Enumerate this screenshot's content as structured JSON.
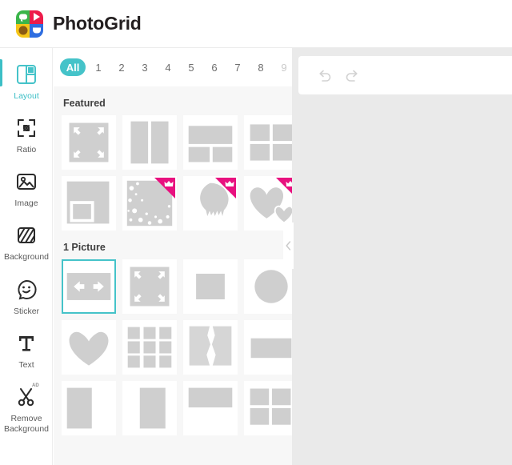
{
  "header": {
    "app_title": "PhotoGrid",
    "logo_colors": {
      "green": "#3bb54a",
      "red": "#ed1c4a",
      "yellow": "#f5c518",
      "blue": "#2f6ee0"
    }
  },
  "theme": {
    "accent": "#45c3c9",
    "premium": "#e8117f",
    "panel_bg": "#f7f7f7",
    "canvas_bg": "#eaeaea"
  },
  "sidebar": {
    "items": [
      {
        "label": "Layout",
        "icon": "layout-icon",
        "active": true
      },
      {
        "label": "Ratio",
        "icon": "ratio-icon",
        "active": false
      },
      {
        "label": "Image",
        "icon": "image-icon",
        "active": false
      },
      {
        "label": "Background",
        "icon": "background-icon",
        "active": false
      },
      {
        "label": "Sticker",
        "icon": "sticker-icon",
        "active": false
      },
      {
        "label": "Text",
        "icon": "text-icon",
        "active": false
      },
      {
        "label": "Remove Background",
        "icon": "scissors-icon",
        "active": false,
        "badge": "AD"
      }
    ]
  },
  "panel": {
    "tabs": [
      {
        "label": "All",
        "active": true
      },
      {
        "label": "1",
        "active": false
      },
      {
        "label": "2",
        "active": false
      },
      {
        "label": "3",
        "active": false
      },
      {
        "label": "4",
        "active": false
      },
      {
        "label": "5",
        "active": false
      },
      {
        "label": "6",
        "active": false
      },
      {
        "label": "7",
        "active": false
      },
      {
        "label": "8",
        "active": false
      },
      {
        "label": "9",
        "active": false,
        "faded": true
      }
    ],
    "next_icon": "chevron-right-icon",
    "sections": [
      {
        "title": "Featured",
        "items": [
          {
            "name": "expand-corners-layout",
            "premium": false,
            "selected": false
          },
          {
            "name": "two-column-layout",
            "premium": false,
            "selected": false
          },
          {
            "name": "one-top-two-bottom-layout",
            "premium": false,
            "selected": false
          },
          {
            "name": "four-grid-layout",
            "premium": false,
            "selected": false
          },
          {
            "name": "frame-inset-layout",
            "premium": false,
            "selected": false
          },
          {
            "name": "snow-texture-layout",
            "premium": true,
            "selected": false
          },
          {
            "name": "paint-drip-layout",
            "premium": true,
            "selected": false
          },
          {
            "name": "double-heart-layout",
            "premium": true,
            "selected": false
          }
        ]
      },
      {
        "title": "1 Picture",
        "items": [
          {
            "name": "wide-arrows-layout",
            "premium": false,
            "selected": true
          },
          {
            "name": "expand-corners-square-layout",
            "premium": false,
            "selected": false
          },
          {
            "name": "small-square-layout",
            "premium": false,
            "selected": false
          },
          {
            "name": "circle-layout",
            "premium": false,
            "selected": false
          },
          {
            "name": "heart-layout",
            "premium": false,
            "selected": false
          },
          {
            "name": "nine-grid-layout",
            "premium": false,
            "selected": false
          },
          {
            "name": "torn-paper-layout",
            "premium": false,
            "selected": false
          },
          {
            "name": "landscape-center-layout",
            "premium": false,
            "selected": false
          },
          {
            "name": "portrait-left-layout",
            "premium": false,
            "selected": false
          },
          {
            "name": "portrait-right-layout",
            "premium": false,
            "selected": false
          },
          {
            "name": "landscape-top-layout",
            "premium": false,
            "selected": false
          },
          {
            "name": "four-grid-small-layout",
            "premium": false,
            "selected": false
          }
        ]
      }
    ],
    "collapse_icon": "chevron-left-icon"
  },
  "canvas": {
    "undo_icon": "undo-icon",
    "redo_icon": "redo-icon"
  }
}
